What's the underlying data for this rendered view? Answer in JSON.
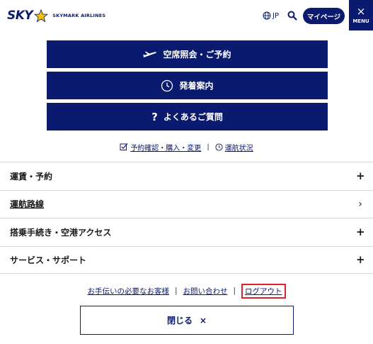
{
  "header": {
    "logo_text": "SKY",
    "logo_subtext": "SKYMARK AIRLINES",
    "lang_label": "JP",
    "mypage_label": "マイページ",
    "menu_label": "MENU",
    "menu_close_symbol": "×"
  },
  "main_buttons": [
    {
      "label": "空席照会・ご予約",
      "icon": "airplane-icon"
    },
    {
      "label": "発着案内",
      "icon": "clock-icon"
    },
    {
      "label": "よくあるご質問",
      "icon": "question-icon",
      "symbol": "?"
    }
  ],
  "sub_links": [
    {
      "label": "予約確認・購入・変更",
      "icon": "checkbox-icon"
    },
    {
      "label": "運航状況",
      "icon": "clock-icon"
    }
  ],
  "sub_links_separator": "|",
  "menu_items": [
    {
      "label": "運賃・予約",
      "symbol": "+",
      "kind": "expand"
    },
    {
      "label": "運航路線",
      "symbol": "›",
      "kind": "link"
    },
    {
      "label": "搭乗手続き・空港アクセス",
      "symbol": "+",
      "kind": "expand"
    },
    {
      "label": "サービス・サポート",
      "symbol": "+",
      "kind": "expand"
    }
  ],
  "footer_links": [
    {
      "label": "お手伝いの必要なお客様"
    },
    {
      "label": "お問い合わせ"
    },
    {
      "label": "ログアウト",
      "highlighted": true
    }
  ],
  "footer_separator": "|",
  "close_button": {
    "label": "閉じる",
    "symbol": "×"
  },
  "colors": {
    "brand_navy": "#0a1a6e",
    "highlight_red": "#e0212b",
    "divider": "#d8d8d8",
    "logo_star": "#f5c400"
  }
}
